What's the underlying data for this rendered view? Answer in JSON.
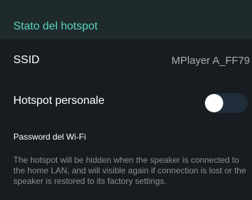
{
  "header": {
    "title": "Stato del hotspot"
  },
  "ssid": {
    "label": "SSID",
    "value": "MPlayer A_FF79"
  },
  "hotspot": {
    "label": "Hotspot personale",
    "enabled": false
  },
  "password": {
    "label": "Password del Wi-Fi"
  },
  "description": "The hotspot will be hidden when the speaker is connected to the home LAN, and will visible again if connection is lost or the speaker is restored to its factory settings.",
  "colors": {
    "accent": "#5cd6bd",
    "background": "#161c1f",
    "header_background": "#1e2a2c",
    "toggle_track": "#1f2c3a",
    "toggle_knob": "#ffffff"
  }
}
